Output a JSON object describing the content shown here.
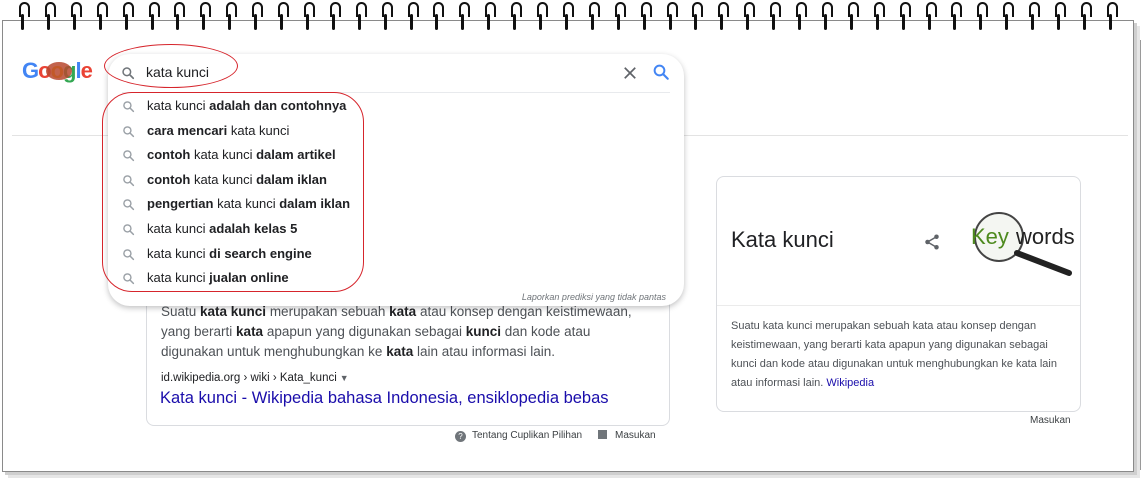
{
  "logo": {
    "letters": [
      "G",
      "o",
      "o",
      "g",
      "l",
      "e"
    ]
  },
  "search": {
    "query": "kata kunci",
    "suggestions": [
      {
        "plain": "kata kunci ",
        "bold": "adalah dan contohnya",
        "order": "plain-bold"
      },
      {
        "plain": " kata kunci",
        "bold": "cara mencari",
        "order": "bold-plain"
      },
      {
        "bold_pre": "contoh",
        "plain": " kata kunci ",
        "bold": "dalam artikel",
        "order": "bold-plain-bold"
      },
      {
        "bold_pre": "contoh",
        "plain": " kata kunci ",
        "bold": "dalam iklan",
        "order": "bold-plain-bold"
      },
      {
        "bold_pre": "pengertian",
        "plain": " kata kunci ",
        "bold": "dalam iklan",
        "order": "bold-plain-bold"
      },
      {
        "plain": "kata kunci ",
        "bold": "adalah kelas 5",
        "order": "plain-bold"
      },
      {
        "plain": "kata kunci ",
        "bold": "di search engine",
        "order": "plain-bold"
      },
      {
        "plain": "kata kunci ",
        "bold": "jualan online",
        "order": "plain-bold"
      }
    ],
    "report_link": "Laporkan prediksi yang tidak pantas"
  },
  "snippet": {
    "text_parts": [
      "Suatu ",
      "kata kunci",
      " merupakan sebuah ",
      "kata",
      " atau konsep dengan keistimewaan, yang berarti ",
      "kata",
      " apapun yang digunakan sebagai ",
      "kunci",
      " dan kode atau digunakan untuk menghubungkan ke ",
      "kata",
      " lain atau informasi lain."
    ],
    "crumb": "id.wikipedia.org › wiki › Kata_kunci",
    "title": "Kata kunci - Wikipedia bahasa Indonesia, ensiklopedia bebas",
    "about": "Tentang Cuplikan Pilihan",
    "feedback": "Masukan"
  },
  "knowledge_panel": {
    "title": "Kata kunci",
    "image_text_a": "Key",
    "image_text_b": "words",
    "description": "Suatu kata kunci merupakan sebuah kata atau konsep dengan keistimewaan, yang berarti kata apapun yang digunakan sebagai kunci dan kode atau digunakan untuk menghubungkan ke kata lain atau informasi lain. ",
    "source_link": "Wikipedia",
    "feedback": "Masukan"
  },
  "colors": {
    "link": "#1a0dab",
    "outline": "#d6252c",
    "icon": "#70757a",
    "go": "#4285f4"
  }
}
